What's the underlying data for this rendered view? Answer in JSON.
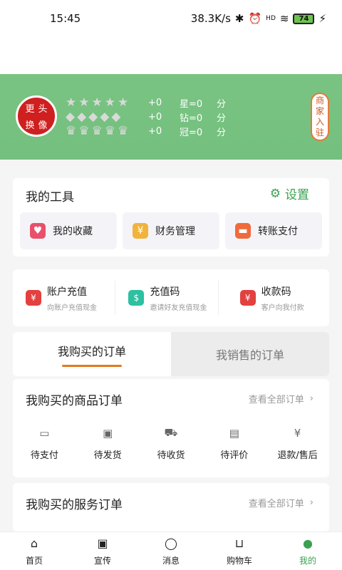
{
  "status": {
    "time": "15:45",
    "speed": "38.3K/s",
    "bluetooth": "✱",
    "alarm": "⏰",
    "signal": "HD",
    "wifi": "≋",
    "battery": "74",
    "charge": "⚡"
  },
  "header": {
    "avatar_chars": [
      "更",
      "头",
      "换",
      "像"
    ],
    "ratings": [
      {
        "icon": "star-icon",
        "glyph": "★",
        "count": 5,
        "plus": "+0",
        "label": "星=0",
        "unit": "分"
      },
      {
        "icon": "diamond-icon",
        "glyph": "◆",
        "count": 5,
        "plus": "+0",
        "label": "钻=0",
        "unit": "分"
      },
      {
        "icon": "crown-icon",
        "glyph": "♛",
        "count": 5,
        "plus": "+0",
        "label": "冠=0",
        "unit": "分"
      }
    ],
    "merchant_label": [
      "商",
      "家",
      "入",
      "驻"
    ]
  },
  "tools": {
    "title": "我的工具",
    "settings_label": "设置",
    "items": [
      {
        "label": "我的收藏",
        "icon": "heart-icon",
        "color": "#e9506b"
      },
      {
        "label": "财务管理",
        "icon": "finance-icon",
        "color": "#f1b33b"
      },
      {
        "label": "转账支付",
        "icon": "transfer-icon",
        "color": "#f06a3c"
      }
    ]
  },
  "payments": [
    {
      "title": "账户充值",
      "desc": "向账户充值现金",
      "icon": "wallet-icon",
      "color": "#e34040"
    },
    {
      "title": "充值码",
      "desc": "邀请好友充值现金",
      "icon": "coin-icon",
      "color": "#2cc1a0"
    },
    {
      "title": "收款码",
      "desc": "客户向我付款",
      "icon": "receive-icon",
      "color": "#e34040"
    }
  ],
  "tabs": {
    "buy": "我购买的订单",
    "sell": "我销售的订单"
  },
  "goods_orders": {
    "title": "我购买的商品订单",
    "view_all": "查看全部订单",
    "items": [
      {
        "label": "待支付",
        "icon": "wallet-outline-icon",
        "glyph": "▭"
      },
      {
        "label": "待发货",
        "icon": "box-icon",
        "glyph": "▣"
      },
      {
        "label": "待收货",
        "icon": "truck-icon",
        "glyph": "⛟"
      },
      {
        "label": "待评价",
        "icon": "comment-icon",
        "glyph": "▤"
      },
      {
        "label": "退款/售后",
        "icon": "refund-icon",
        "glyph": "¥"
      }
    ]
  },
  "service_orders": {
    "title": "我购买的服务订单",
    "view_all": "查看全部订单"
  },
  "nav": [
    {
      "label": "首页",
      "icon": "home-icon",
      "glyph": "⌂",
      "active": false
    },
    {
      "label": "宣传",
      "icon": "promo-icon",
      "glyph": "▣",
      "active": false
    },
    {
      "label": "消息",
      "icon": "message-icon",
      "glyph": "◯",
      "active": false
    },
    {
      "label": "购物车",
      "icon": "cart-icon",
      "glyph": "⊔",
      "active": false
    },
    {
      "label": "我的",
      "icon": "profile-icon",
      "glyph": "●",
      "active": true
    }
  ]
}
